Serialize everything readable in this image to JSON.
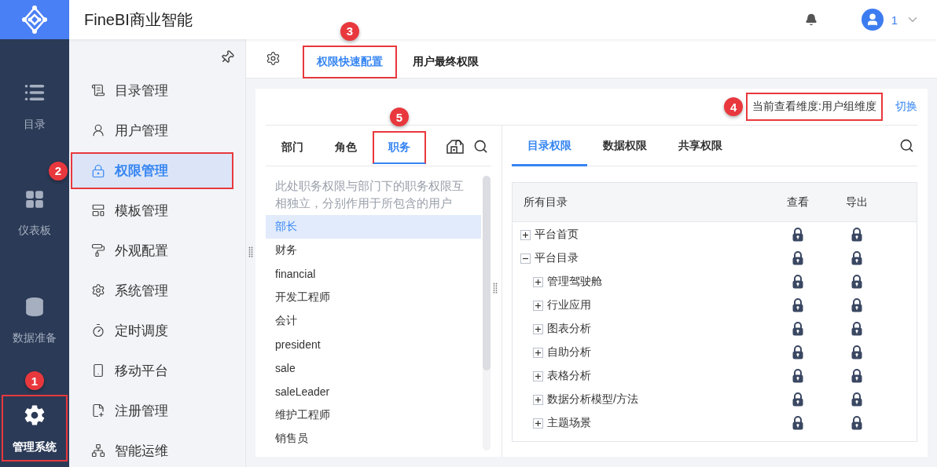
{
  "header": {
    "title": "FineBI商业智能",
    "user": "1"
  },
  "rail": [
    {
      "label": "目录",
      "selected": false,
      "highlighted": false
    },
    {
      "label": "仪表板",
      "selected": false,
      "highlighted": false
    },
    {
      "label": "数据准备",
      "selected": false,
      "highlighted": false
    },
    {
      "label": "管理系统",
      "selected": true,
      "highlighted": true,
      "marker": "1"
    }
  ],
  "menu": [
    {
      "label": "目录管理",
      "selected": false,
      "highlighted": false
    },
    {
      "label": "用户管理",
      "selected": false,
      "highlighted": false
    },
    {
      "label": "权限管理",
      "selected": true,
      "highlighted": true,
      "marker": "2"
    },
    {
      "label": "模板管理",
      "selected": false,
      "highlighted": false
    },
    {
      "label": "外观配置",
      "selected": false,
      "highlighted": false
    },
    {
      "label": "系统管理",
      "selected": false,
      "highlighted": false
    },
    {
      "label": "定时调度",
      "selected": false,
      "highlighted": false
    },
    {
      "label": "移动平台",
      "selected": false,
      "highlighted": false
    },
    {
      "label": "注册管理",
      "selected": false,
      "highlighted": false
    },
    {
      "label": "智能运维",
      "selected": false,
      "highlighted": false
    }
  ],
  "page_tabs": [
    {
      "label": "权限快速配置",
      "selected": true,
      "highlighted": true,
      "marker": "3"
    },
    {
      "label": "用户最终权限",
      "selected": false,
      "highlighted": false
    }
  ],
  "dimension": {
    "label": "当前查看维度:用户组维度",
    "highlighted": true,
    "marker": "4",
    "switch_link": "切换"
  },
  "group_tabs": [
    {
      "label": "部门",
      "selected": false,
      "highlighted": false
    },
    {
      "label": "角色",
      "selected": false,
      "highlighted": false
    },
    {
      "label": "职务",
      "selected": true,
      "highlighted": true,
      "marker": "5"
    }
  ],
  "group_note": "此处职务权限与部门下的职务权限互相独立，分别作用于所包含的用户",
  "groups": [
    {
      "label": "部长",
      "selected": true
    },
    {
      "label": "财务",
      "selected": false
    },
    {
      "label": "financial",
      "selected": false
    },
    {
      "label": "开发工程师",
      "selected": false
    },
    {
      "label": "会计",
      "selected": false
    },
    {
      "label": "president",
      "selected": false
    },
    {
      "label": "sale",
      "selected": false
    },
    {
      "label": "saleLeader",
      "selected": false
    },
    {
      "label": "维护工程师",
      "selected": false
    },
    {
      "label": "销售员",
      "selected": false
    }
  ],
  "permission_tabs": [
    {
      "label": "目录权限",
      "selected": true
    },
    {
      "label": "数据权限",
      "selected": false
    },
    {
      "label": "共享权限",
      "selected": false
    }
  ],
  "table": {
    "columns": [
      "所有目录",
      "查看",
      "导出"
    ],
    "rows": [
      {
        "label": "平台首页",
        "expanded": false,
        "view_locked": true,
        "export_locked": true
      },
      {
        "label": "平台目录",
        "expanded": true,
        "view_locked": true,
        "export_locked": true,
        "children": [
          {
            "label": "管理驾驶舱",
            "expanded": false,
            "view_locked": true,
            "export_locked": true
          },
          {
            "label": "行业应用",
            "expanded": false,
            "view_locked": true,
            "export_locked": true
          },
          {
            "label": "图表分析",
            "expanded": false,
            "view_locked": true,
            "export_locked": true
          },
          {
            "label": "自助分析",
            "expanded": false,
            "view_locked": true,
            "export_locked": true
          },
          {
            "label": "表格分析",
            "expanded": false,
            "view_locked": true,
            "export_locked": true
          },
          {
            "label": "数据分析模型/方法",
            "expanded": false,
            "view_locked": true,
            "export_locked": true
          },
          {
            "label": "主题场景",
            "expanded": false,
            "view_locked": true,
            "export_locked": true
          }
        ]
      }
    ]
  }
}
